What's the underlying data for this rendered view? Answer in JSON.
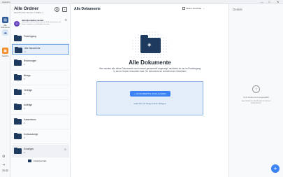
{
  "titlebar": {
    "app_title": "ScanPro",
    "minimize": "—",
    "maximize": "□",
    "close": "✕"
  },
  "rail": {
    "items": [
      {
        "label": "Alle Dokumente",
        "icon": "document-icon"
      },
      {
        "label": "",
        "icon": "cloud-icon"
      },
      {
        "label": "ScanPro",
        "icon": "scanpro-icon"
      }
    ],
    "time": "20:32",
    "colors": {
      "active": "#2e5c9a",
      "brand": "#f28c28"
    }
  },
  "folders": {
    "title": "Alle Ordner",
    "subtitle": "ScanPro Pro Version 7 Plätze 1",
    "promo": {
      "title": "Jetzt kostenlos testen",
      "text": "Greifen Sie auf Ihre Dokumente mit Ihrer Smartphone und Ihrem Computer zu und bleiben Sie auch"
    },
    "items": [
      {
        "name": "Posteingang",
        "count": "",
        "selected": false
      },
      {
        "name": "Alle Dokumente",
        "count": "0",
        "selected": true
      },
      {
        "name": "Rechnungen",
        "count": "0",
        "selected": false
      },
      {
        "name": "Belege",
        "count": "0",
        "selected": false
      },
      {
        "name": "Verträge",
        "count": "0",
        "selected": false
      },
      {
        "name": "Aufträge",
        "count": "0",
        "selected": false
      },
      {
        "name": "Kassenbons",
        "count": "0",
        "selected": false
      },
      {
        "name": "Kontoauszüge",
        "count": "0",
        "selected": false
      },
      {
        "name": "Sonstiges",
        "count": "0",
        "selected": false
      }
    ],
    "subfolder": "Finanzjournale"
  },
  "main": {
    "title": "Alle Dokumente",
    "sort_label": "Kleine Vorschau",
    "empty_title": "Alle Dokumente",
    "empty_desc": "Hier werden alle deine Dokumente noch einmal gesammelt angezeigt, nachdem du sie im Posteingang in einen Ordner einsortiert hast. So bekommst du schnell einen Überblick!",
    "import_button": "DOKUMENTE HOCHLADEN",
    "drop_hint": "oder hier per Drag & Drop ablegen"
  },
  "details": {
    "title": "Details",
    "none_selected": "Kein Dokument ausgewählt",
    "hint": "Hier findest du die Details zu deinen Dokumenten"
  },
  "fab_label": "+"
}
